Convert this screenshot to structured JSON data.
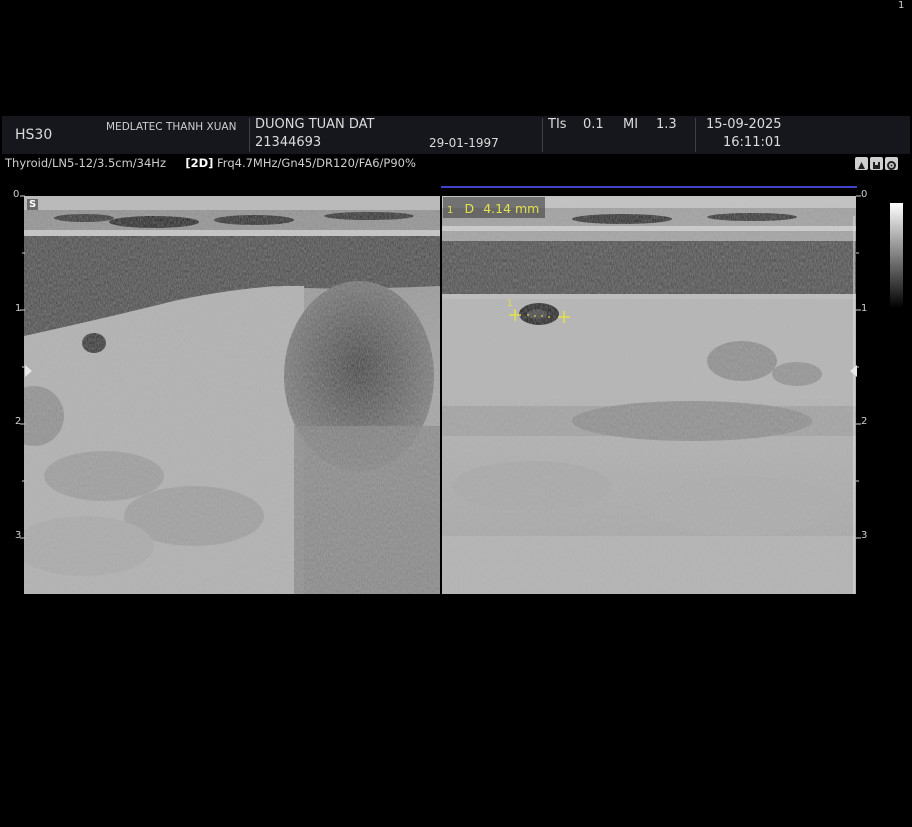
{
  "header": {
    "model": "HS30",
    "institution": "MEDLATEC THANH XUAN",
    "patient_name": "DUONG TUAN DAT",
    "patient_id": "21344693",
    "birth_date": "29-01-1997",
    "tis_label": "TIs",
    "tis_value": "0.1",
    "mi_label": "MI",
    "mi_value": "1.3",
    "date": "15-09-2025",
    "time": "16:11:01"
  },
  "corner_mark": "1",
  "params": {
    "preset": "Thyroid/LN5-12/3.5cm/34Hz",
    "mode": "[2D]",
    "settings": "Frq4.7MHz/Gn45/DR120/FA6/P90%"
  },
  "depth_ticks_left": [
    "0",
    "1",
    "2",
    "3"
  ],
  "depth_ticks_right": [
    "0",
    "1",
    "2",
    "3"
  ],
  "left_image": {
    "marker": "S"
  },
  "right_image": {
    "measurement_index": "1",
    "measurement_label": "D",
    "measurement_value": "4.14 mm",
    "caliper_index": "1"
  },
  "icons": [
    "probe-icon",
    "save-icon",
    "settings-icon"
  ],
  "colors": {
    "header_bg": "#15171c",
    "measurement": "#e3e24a",
    "active_line": "#3f45c8"
  }
}
